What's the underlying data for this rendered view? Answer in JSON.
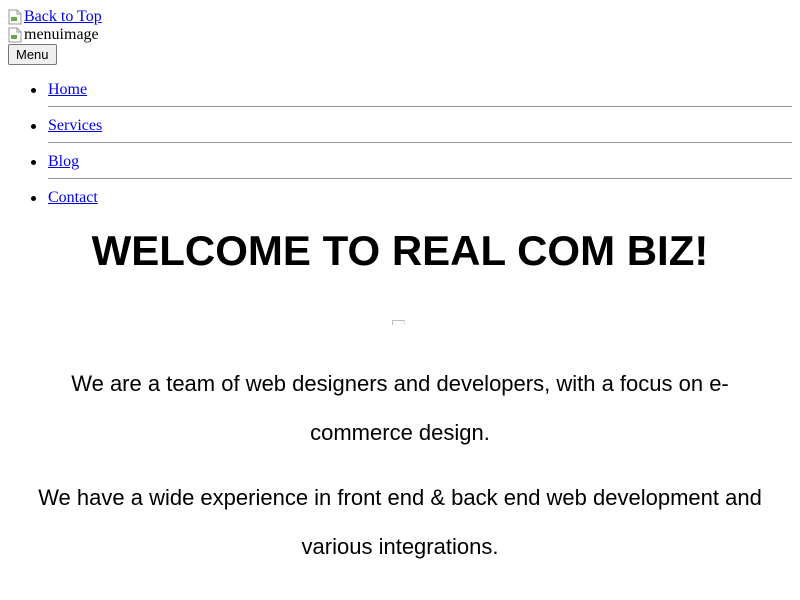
{
  "header": {
    "back_to_top_alt": "Back to Top",
    "menu_image_alt": "menuimage",
    "menu_button_label": "Menu"
  },
  "nav": {
    "items": [
      {
        "label": "Home"
      },
      {
        "label": "Services"
      },
      {
        "label": "Blog"
      },
      {
        "label": "Contact"
      }
    ]
  },
  "main": {
    "title": "WELCOME TO REAL COM BIZ!",
    "paragraphs": [
      "We are a team of web designers and developers, with a focus on e-commerce design.",
      "We have a wide experience in front end & back end web development and various integrations."
    ]
  },
  "colors": {
    "link": "#0000ee",
    "text": "#000000",
    "background": "#ffffff"
  }
}
